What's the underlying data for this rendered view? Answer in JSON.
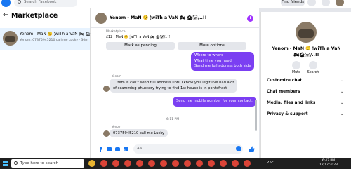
{
  "topbar": {
    "search_placeholder": "Search Facebook",
    "find_friends": "Find friends"
  },
  "left": {
    "back_icon": "arrow-left-icon",
    "title": "Marketplace",
    "conversation": {
      "name": "Yenom - MaN 🤨 🕯wiTh a VaN 🏍 🏚🐼/..",
      "preview": "Yenom: 07375945210 call me Lucky · 30m"
    }
  },
  "chat": {
    "header_name": "Yenom - MaN 🤨 🕯wiTh a VaN 🏍 🏚🐼/..!!",
    "info_icon": "info-icon",
    "marketplace_label": "Marketplace",
    "marketplace_item": "£12 · MaN 🤨 🕯wiTh a VaN 🏍 🏚🐼/..!!",
    "mark_pending": "Mark as pending",
    "more_options": "More options",
    "outgoing_1": [
      "Where to where",
      "What time you need",
      "Send me full address both side"
    ],
    "sender": "Yenom",
    "incoming_1": [
      "1 item is can't send full address until I know you legit I've had alot",
      "of scamming phuckery trying to find 1st house is in pontefract"
    ],
    "outgoing_2": "Send me mobile nomber for your contact.",
    "time": "6:11 PM",
    "sender_2": "Yenom",
    "incoming_2": "07375945210 call me Lucky",
    "composer_placeholder": "Aa"
  },
  "right": {
    "name_line1": "Yenom - MaN 🤨 🕯wiTh a VaN",
    "name_line2": "🏍🏚🐼/..!!",
    "mute": "Mute",
    "search": "Search",
    "sections": [
      "Customize chat",
      "Chat members",
      "Media, files and links",
      "Privacy & support"
    ]
  },
  "taskbar": {
    "search": "Type here to search",
    "weather": "25°C",
    "time": "6:47 PM",
    "date": "12/17/2023"
  }
}
